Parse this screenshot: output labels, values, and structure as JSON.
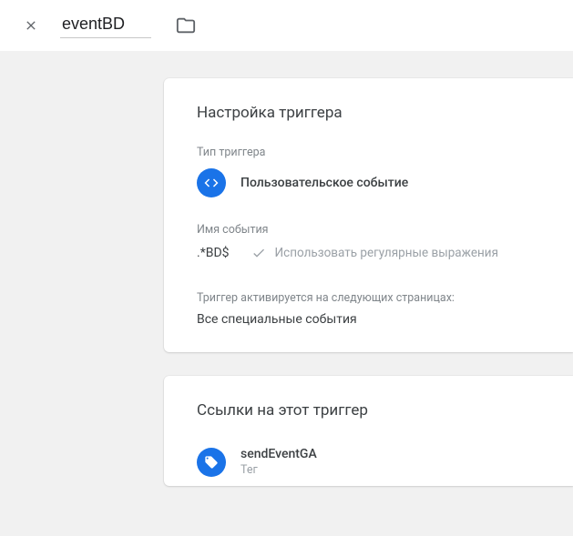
{
  "header": {
    "title_value": "eventBD"
  },
  "cards": {
    "config": {
      "title": "Настройка триггера",
      "type_label": "Тип триггера",
      "type_value": "Пользовательское событие",
      "event_name_label": "Имя события",
      "event_name_value": ".*BD$",
      "regex_label": "Использовать регулярные выражения",
      "fires_on_label": "Триггер активируется на следующих страницах:",
      "fires_on_value": "Все специальные события"
    },
    "refs": {
      "title": "Ссылки на этот триггер",
      "item_name": "sendEventGA",
      "item_type": "Тег"
    }
  },
  "icons": {
    "close": "close-icon",
    "folder": "folder-icon",
    "custom_event": "code-angle-icon",
    "check": "check-icon",
    "tag": "tag-icon"
  },
  "colors": {
    "accent": "#1a73e8",
    "grey_bg": "#f1f1f1",
    "text_muted": "#80868b"
  }
}
